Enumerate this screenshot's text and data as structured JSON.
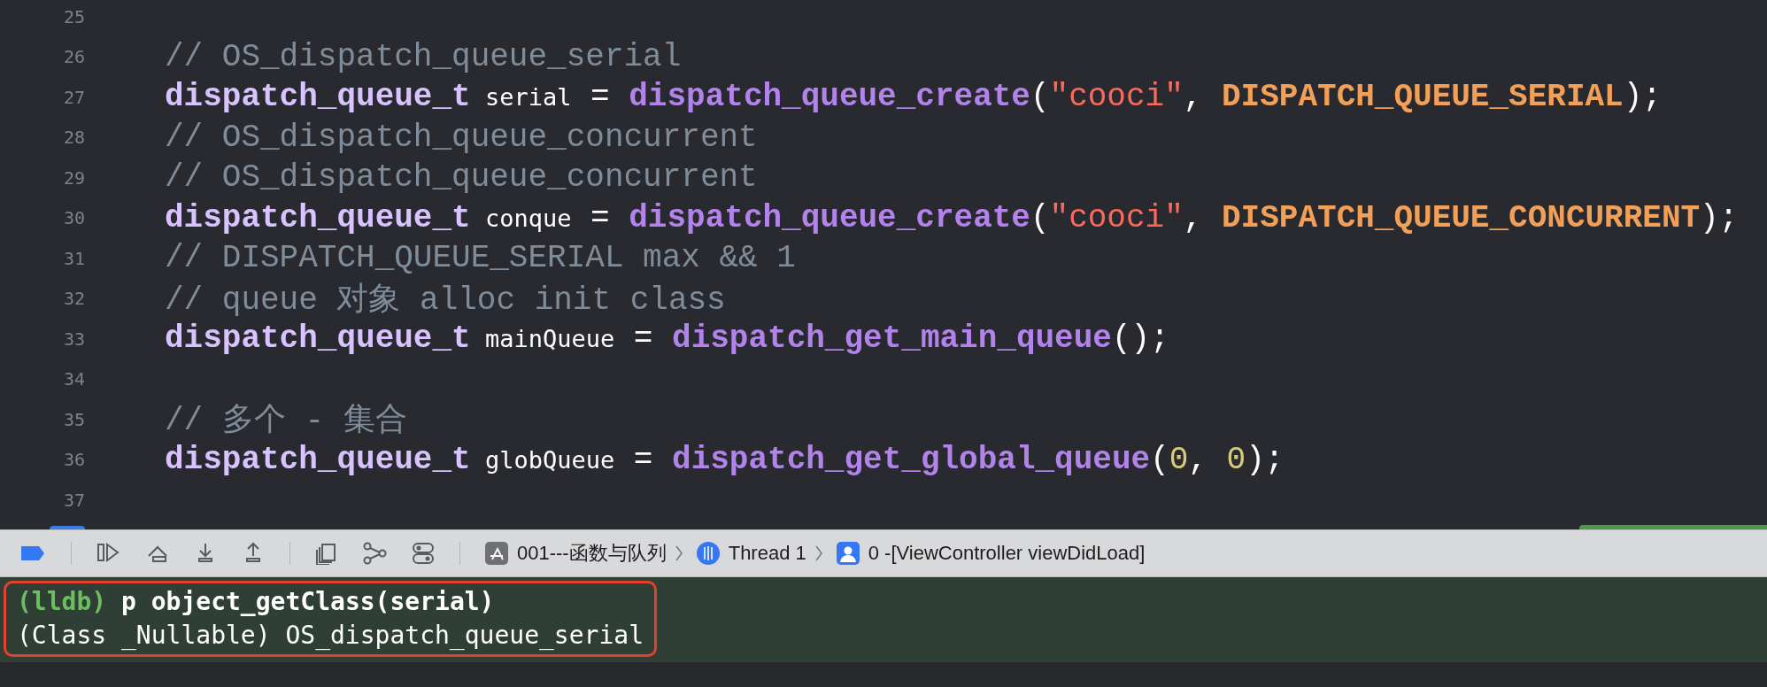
{
  "editor": {
    "lines": [
      {
        "number": "25"
      },
      {
        "number": "26",
        "tokens": [
          {
            "kind": "comment",
            "text": "// OS_dispatch_queue_serial"
          }
        ]
      },
      {
        "number": "27",
        "tokens": [
          {
            "kind": "type",
            "text": "dispatch_queue_t"
          },
          {
            "kind": "var",
            "text": " serial"
          },
          {
            "kind": "plain",
            "text": " = "
          },
          {
            "kind": "func",
            "text": "dispatch_queue_create"
          },
          {
            "kind": "plain",
            "text": "("
          },
          {
            "kind": "string",
            "text": "\"cooci\""
          },
          {
            "kind": "plain",
            "text": ", "
          },
          {
            "kind": "macro",
            "text": "DISPATCH_QUEUE_SERIAL"
          },
          {
            "kind": "plain",
            "text": ");"
          }
        ]
      },
      {
        "number": "28",
        "tokens": [
          {
            "kind": "comment",
            "text": "// OS_dispatch_queue_concurrent"
          }
        ]
      },
      {
        "number": "29",
        "tokens": [
          {
            "kind": "comment",
            "text": "// OS_dispatch_queue_concurrent"
          }
        ]
      },
      {
        "number": "30",
        "tokens": [
          {
            "kind": "type",
            "text": "dispatch_queue_t"
          },
          {
            "kind": "var",
            "text": " conque"
          },
          {
            "kind": "plain",
            "text": " = "
          },
          {
            "kind": "func",
            "text": "dispatch_queue_create"
          },
          {
            "kind": "plain",
            "text": "("
          },
          {
            "kind": "string",
            "text": "\"cooci\""
          },
          {
            "kind": "plain",
            "text": ", "
          },
          {
            "kind": "macro",
            "text": "DISPATCH_QUEUE_CONCURRENT"
          },
          {
            "kind": "plain",
            "text": ");"
          }
        ]
      },
      {
        "number": "31",
        "tokens": [
          {
            "kind": "comment",
            "text": "// DISPATCH_QUEUE_SERIAL max && 1"
          }
        ]
      },
      {
        "number": "32",
        "tokens": [
          {
            "kind": "comment",
            "text": "// queue 对象 alloc init class"
          }
        ]
      },
      {
        "number": "33",
        "tokens": [
          {
            "kind": "type",
            "text": "dispatch_queue_t"
          },
          {
            "kind": "var",
            "text": " mainQueue"
          },
          {
            "kind": "plain",
            "text": " = "
          },
          {
            "kind": "func",
            "text": "dispatch_get_main_queue"
          },
          {
            "kind": "plain",
            "text": "();"
          }
        ]
      },
      {
        "number": "34"
      },
      {
        "number": "35",
        "tokens": [
          {
            "kind": "comment",
            "text": "// 多个 - 集合"
          }
        ]
      },
      {
        "number": "36",
        "tokens": [
          {
            "kind": "type",
            "text": "dispatch_queue_t"
          },
          {
            "kind": "var",
            "text": " globQueue"
          },
          {
            "kind": "plain",
            "text": " = "
          },
          {
            "kind": "func",
            "text": "dispatch_get_global_queue"
          },
          {
            "kind": "plain",
            "text": "("
          },
          {
            "kind": "number",
            "text": "0"
          },
          {
            "kind": "plain",
            "text": ", "
          },
          {
            "kind": "number",
            "text": "0"
          },
          {
            "kind": "plain",
            "text": ");"
          }
        ]
      },
      {
        "number": "37"
      }
    ]
  },
  "debug_bar": {
    "breakpoints_active": true,
    "breadcrumbs": [
      {
        "kind": "app",
        "label": "001---函数与队列"
      },
      {
        "kind": "thread",
        "label": "Thread 1"
      },
      {
        "kind": "frame",
        "label": "0 -[ViewController viewDidLoad]"
      }
    ]
  },
  "console": {
    "highlighted": true,
    "lines": [
      {
        "prompt": "(lldb)",
        "text": " p object_getClass(serial)"
      },
      {
        "text": "(Class _Nullable) OS_dispatch_queue_serial"
      }
    ]
  }
}
